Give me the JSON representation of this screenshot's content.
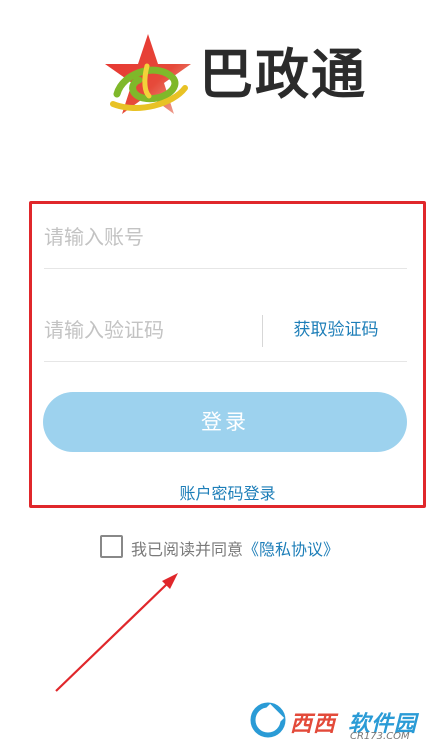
{
  "app": {
    "name": "巴政通"
  },
  "login_form": {
    "account_placeholder": "请输入账号",
    "code_placeholder": "请输入验证码",
    "get_code_label": "获取验证码",
    "login_label": "登录",
    "password_login_label": "账户密码登录"
  },
  "agreement": {
    "checked": false,
    "prefix": "我已阅读并同意",
    "link_label": "《隐私协议》"
  },
  "watermark": {
    "brand_a": "西西",
    "brand_b": "软件园",
    "site": "CR173.COM"
  },
  "colors": {
    "accent_blue": "#1d7eb8",
    "button_blue": "#9dd2ee",
    "highlight_red": "#e0272b"
  }
}
